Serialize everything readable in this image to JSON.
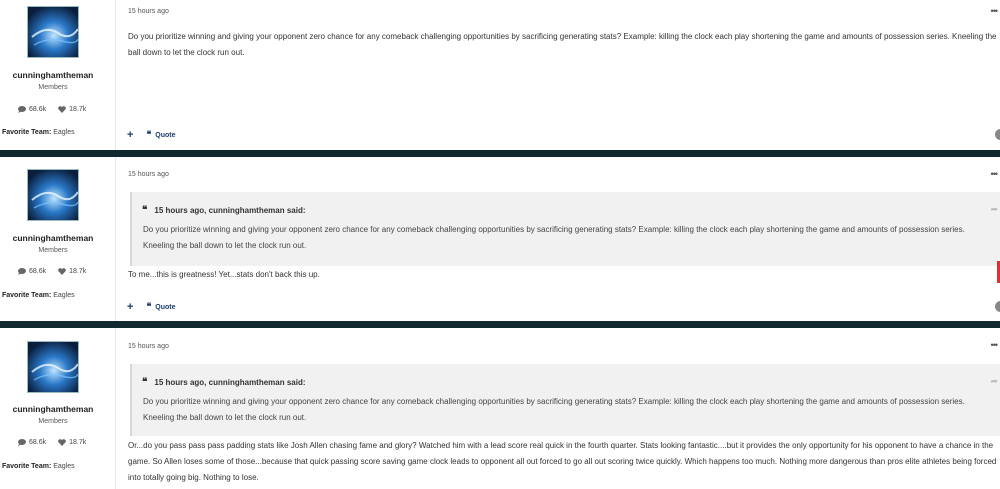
{
  "posts": [
    {
      "author": {
        "username": "cunninghamtheman",
        "group": "Members",
        "comments_count": "68.6k",
        "reputation": "18.7k",
        "favorite_team_label": "Favorite Team:",
        "favorite_team": "Eagles",
        "avatar_icon": "avatar-image"
      },
      "time": "15 hours ago",
      "body": "Do you prioritize winning and giving your opponent zero chance for any comeback challenging opportunities by sacrificing generating stats? Example: killing the clock each play shortening the game and amounts of possession series. Kneeling the ball down to let the clock run out.",
      "actions": {
        "plus": "+",
        "quote_label": "Quote"
      }
    },
    {
      "author": {
        "username": "cunninghamtheman",
        "group": "Members",
        "comments_count": "68.6k",
        "reputation": "18.7k",
        "favorite_team_label": "Favorite Team:",
        "favorite_team": "Eagles",
        "avatar_icon": "avatar-image"
      },
      "time": "15 hours ago",
      "quote": {
        "attribution": "15 hours ago, cunninghamtheman said:",
        "text": "Do you prioritize winning and giving your opponent zero chance for any comeback challenging opportunities by sacrificing generating stats? Example: killing the clock each play shortening the game and amounts of possession series. Kneeling the ball down to let the clock run out."
      },
      "body": "To me...this is greatness! Yet...stats don't back this up.",
      "actions": {
        "plus": "+",
        "quote_label": "Quote"
      }
    },
    {
      "author": {
        "username": "cunninghamtheman",
        "group": "Members",
        "comments_count": "68.6k",
        "reputation": "18.7k",
        "favorite_team_label": "Favorite Team:",
        "favorite_team": "Eagles",
        "avatar_icon": "avatar-image"
      },
      "time": "15 hours ago",
      "quote": {
        "attribution": "15 hours ago, cunninghamtheman said:",
        "text": "Do you prioritize winning and giving your opponent zero chance for any comeback challenging opportunities by sacrificing generating stats? Example: killing the clock each play shortening the game and amounts of possession series. Kneeling the ball down to let the clock run out."
      },
      "body": "Or...do you pass pass pass padding stats like Josh Allen chasing fame and glory? Watched him with a lead score real quick in the fourth quarter. Stats looking fantastic....but it provides the only opportunity for his opponent to have a chance in the game. So Allen loses some of those...because that quick passing score saving game clock leads to opponent all out forced to go all out scoring twice quickly. Which happens too much. Nothing more dangerous than pros elite athletes being forced into totally going big. Nothing to lose."
    }
  ],
  "colors": {
    "separator": "#10292f",
    "action_blue": "#1b3d6d",
    "quote_bg": "#f1f1f1"
  }
}
